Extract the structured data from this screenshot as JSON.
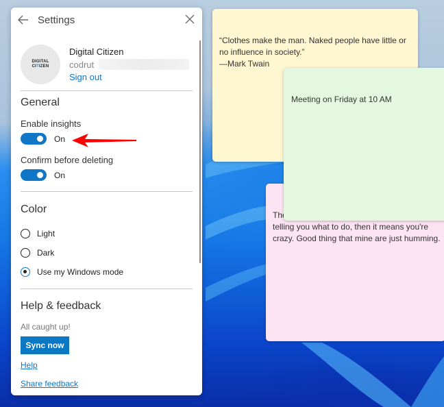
{
  "settings": {
    "title": "Settings",
    "back_icon": "arrow-left-icon",
    "close_icon": "close-icon",
    "account": {
      "avatar_line1": "DIGITAL",
      "avatar_line2_a": "CI",
      "avatar_line2_b": "T",
      "avatar_line2_c": "IZEN",
      "name": "Digital Citizen",
      "email_visible": "codrut",
      "sign_out": "Sign out"
    },
    "general": {
      "title": "General",
      "enable_insights": {
        "label": "Enable insights",
        "state": "On",
        "enabled": true
      },
      "confirm_delete": {
        "label": "Confirm before deleting",
        "state": "On",
        "enabled": true
      }
    },
    "color": {
      "title": "Color",
      "options": [
        {
          "label": "Light",
          "selected": false
        },
        {
          "label": "Dark",
          "selected": false
        },
        {
          "label": "Use my Windows mode",
          "selected": true
        }
      ]
    },
    "help": {
      "title": "Help & feedback",
      "status": "All caught up!",
      "sync_button": "Sync now",
      "help_link": "Help",
      "feedback_link": "Share feedback"
    },
    "accent_color": "#1077c8"
  },
  "notes": [
    {
      "color": "#fef7d2",
      "text": "“Clothes make the man. Naked people have little or no influence in society.”\n—Mark Twain"
    },
    {
      "color": "#e4f8e0",
      "text": "Meeting on Friday at 10 AM"
    },
    {
      "color": "#fde4f2",
      "text_visible_prefix": "The",
      "text": "telling you what to do, then it means you're crazy. Good thing that mine are just humming."
    }
  ],
  "annotation": {
    "type": "red-arrow",
    "points_to": "enable-insights-toggle",
    "color": "#ff0000"
  }
}
